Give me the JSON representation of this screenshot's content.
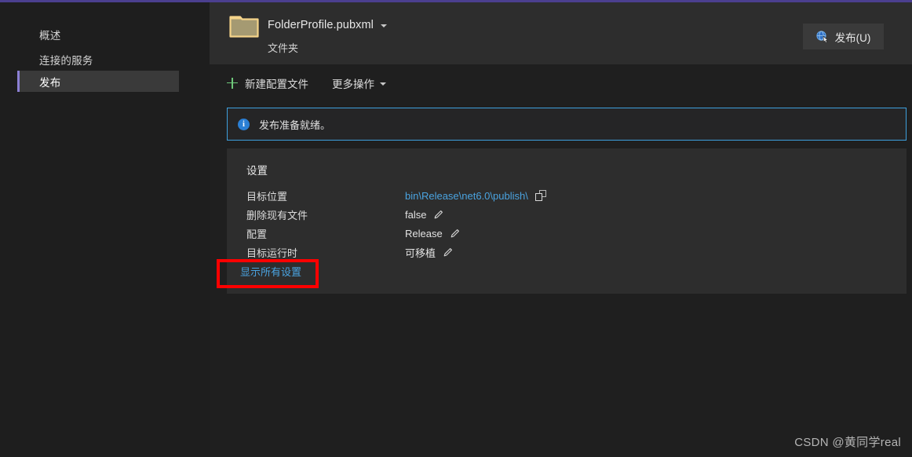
{
  "sidebar": {
    "items": [
      {
        "label": "概述",
        "selected": false
      },
      {
        "label": "连接的服务",
        "selected": false
      },
      {
        "label": "发布",
        "selected": true
      }
    ]
  },
  "header": {
    "folder_icon": "folder-icon",
    "profile_name": "FolderProfile.pubxml",
    "profile_dropdown_icon": "chevron-down-icon",
    "profile_subtitle": "文件夹",
    "publish_button": {
      "label": "发布(U)",
      "icon": "publish-globe-icon"
    }
  },
  "toolbar": {
    "new_profile": {
      "label": "新建配置文件",
      "icon": "plus-icon"
    },
    "more_actions": {
      "label": "更多操作",
      "icon": "chevron-down-icon"
    }
  },
  "banner": {
    "icon": "info-icon",
    "icon_glyph": "i",
    "message": "发布准备就绪。",
    "border_color": "#3ea0dd"
  },
  "settings": {
    "title": "设置",
    "rows": [
      {
        "label": "目标位置",
        "value": "bin\\Release\\net6.0\\publish\\",
        "value_kind": "link",
        "action_icon": "copy-icon"
      },
      {
        "label": "删除现有文件",
        "value": "false",
        "value_kind": "text",
        "action_icon": "pencil-icon"
      },
      {
        "label": "配置",
        "value": "Release",
        "value_kind": "text",
        "action_icon": "pencil-icon"
      },
      {
        "label": "目标运行时",
        "value": "可移植",
        "value_kind": "text",
        "action_icon": "pencil-icon"
      }
    ],
    "show_all_label": "显示所有设置"
  },
  "annotation": {
    "color": "#fe0000",
    "target": "显示所有设置"
  },
  "watermark": {
    "text": "CSDN @黄同学real"
  },
  "theme": {
    "window_background": "#1f1f1f",
    "sidebar_background": "#1e1e1e",
    "card_background": "#2d2d2d",
    "accent_purple": "#8b7fd4",
    "link_blue": "#4aa3e0",
    "plus_green": "#6ec77a",
    "folder_gold": "#f5d48a"
  }
}
